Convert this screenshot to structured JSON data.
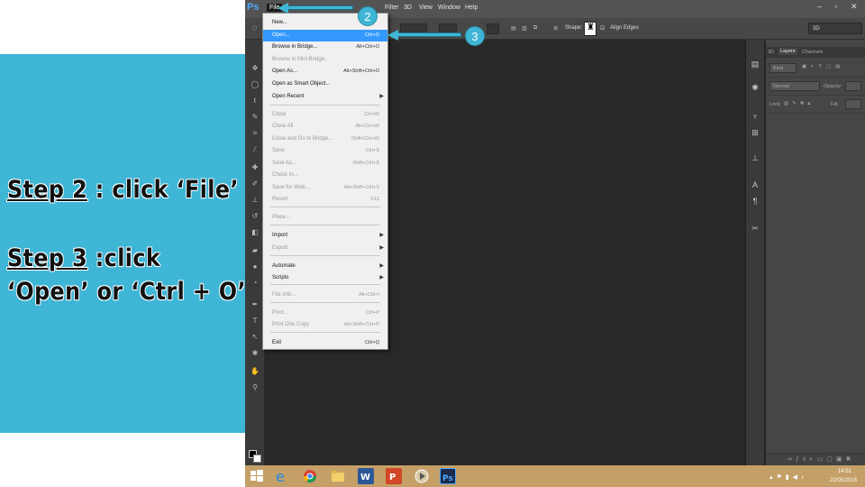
{
  "slide": {
    "step2_label": "Step 2",
    "step2_rest": " : click ‘File’",
    "step3_label": "Step 3",
    "step3_rest": " :click",
    "step3_line2": "‘Open’ or ‘Ctrl + O’"
  },
  "app": {
    "logo": "Ps",
    "menus": [
      "File",
      "Filter",
      "3D",
      "View",
      "Window",
      "Help"
    ],
    "options": {
      "shape_label": "Shape:",
      "align_edges_label": "Align Edges"
    },
    "workspace": "3D"
  },
  "file_menu": {
    "items": [
      {
        "label": "New...",
        "shortcut": "",
        "enabled": true
      },
      {
        "label": "Open...",
        "shortcut": "Ctrl+O",
        "enabled": true,
        "highlighted": true
      },
      {
        "label": "Browse in Bridge...",
        "shortcut": "Alt+Ctrl+O",
        "enabled": true
      },
      {
        "label": "Browse in Mini Bridge...",
        "shortcut": "",
        "enabled": false
      },
      {
        "label": "Open As...",
        "shortcut": "Alt+Shift+Ctrl+O",
        "enabled": true
      },
      {
        "label": "Open as Smart Object...",
        "shortcut": "",
        "enabled": true
      },
      {
        "label": "Open Recent",
        "shortcut": "",
        "enabled": true,
        "submenu": true
      },
      {
        "label": "Close",
        "shortcut": "Ctrl+W",
        "enabled": false
      },
      {
        "label": "Close All",
        "shortcut": "Alt+Ctrl+W",
        "enabled": false
      },
      {
        "label": "Close and Go to Bridge...",
        "shortcut": "Shift+Ctrl+W",
        "enabled": false
      },
      {
        "label": "Save",
        "shortcut": "Ctrl+S",
        "enabled": false
      },
      {
        "label": "Save As...",
        "shortcut": "Shift+Ctrl+S",
        "enabled": false
      },
      {
        "label": "Check In...",
        "shortcut": "",
        "enabled": false
      },
      {
        "label": "Save for Web...",
        "shortcut": "Alt+Shift+Ctrl+S",
        "enabled": false
      },
      {
        "label": "Revert",
        "shortcut": "F12",
        "enabled": false
      },
      {
        "label": "Place...",
        "shortcut": "",
        "enabled": false
      },
      {
        "label": "Import",
        "shortcut": "",
        "enabled": true,
        "submenu": true
      },
      {
        "label": "Export",
        "shortcut": "",
        "enabled": false,
        "submenu": true
      },
      {
        "label": "Automate",
        "shortcut": "",
        "enabled": true,
        "submenu": true
      },
      {
        "label": "Scripts",
        "shortcut": "",
        "enabled": true,
        "submenu": true
      },
      {
        "label": "File Info...",
        "shortcut": "Alt+Ctrl+I",
        "enabled": false
      },
      {
        "label": "Print...",
        "shortcut": "Ctrl+P",
        "enabled": false
      },
      {
        "label": "Print One Copy",
        "shortcut": "Alt+Shift+Ctrl+P",
        "enabled": false
      },
      {
        "label": "Exit",
        "shortcut": "Ctrl+Q",
        "enabled": true
      }
    ]
  },
  "callouts": {
    "file_badge": "2",
    "open_badge": "3"
  },
  "layers_panel": {
    "tabs": [
      "3D",
      "Layers",
      "Channels"
    ],
    "kind_label": "Kind",
    "blend_mode": "Normal",
    "opacity_label": "Opacity:",
    "lock_label": "Lock:",
    "fill_label": "Fill:"
  },
  "taskbar": {
    "time": "14:51",
    "date": "22/05/2015"
  },
  "colors": {
    "slide_accent": "#3fb6d6",
    "menu_highlight": "#3399ff",
    "taskbar": "#c4a068"
  }
}
